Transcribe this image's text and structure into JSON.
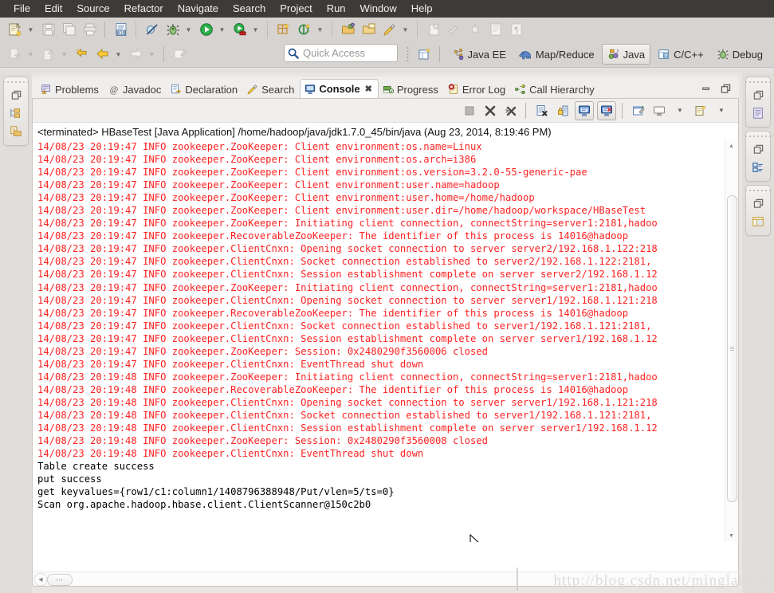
{
  "menu": {
    "items": [
      {
        "label": "File"
      },
      {
        "label": "Edit"
      },
      {
        "label": "Source"
      },
      {
        "label": "Refactor"
      },
      {
        "label": "Navigate"
      },
      {
        "label": "Search"
      },
      {
        "label": "Project"
      },
      {
        "label": "Run"
      },
      {
        "label": "Window"
      },
      {
        "label": "Help"
      }
    ]
  },
  "toolbar": {
    "quick_access_placeholder": "Quick Access",
    "icons_row1": [
      "new-wizard-icon",
      "save-icon",
      "save-all-icon",
      "print-icon",
      "toggle-source-icon",
      "skip-breakpoints-icon",
      "debug-icon",
      "run-icon",
      "run-external-tools-icon",
      "new-java-package-icon",
      "new-java-class-icon",
      "open-type-icon",
      "open-task-icon",
      "search-icon"
    ],
    "icons_row2": [
      "previous-annotation-icon",
      "next-annotation-icon",
      "last-edit-icon",
      "back-icon",
      "forward-icon",
      "pin-editor-icon"
    ]
  },
  "perspectives": {
    "items": [
      {
        "label": "Java EE",
        "icon": "java-ee-perspective-icon",
        "active": false
      },
      {
        "label": "Map/Reduce",
        "icon": "map-reduce-perspective-icon",
        "active": false
      },
      {
        "label": "Java",
        "icon": "java-perspective-icon",
        "active": true
      },
      {
        "label": "C/C++",
        "icon": "c-cpp-perspective-icon",
        "active": false
      },
      {
        "label": "Debug",
        "icon": "debug-perspective-icon",
        "active": false
      }
    ],
    "open_perspective_label": "Open Perspective"
  },
  "view_tabs": [
    {
      "label": "Problems",
      "icon": "problems-icon",
      "active": false
    },
    {
      "label": "Javadoc",
      "icon": "javadoc-icon",
      "active": false
    },
    {
      "label": "Declaration",
      "icon": "declaration-icon",
      "active": false
    },
    {
      "label": "Search",
      "icon": "search-view-icon",
      "active": false
    },
    {
      "label": "Console",
      "icon": "console-icon",
      "active": true,
      "close": "✖"
    },
    {
      "label": "Progress",
      "icon": "progress-icon",
      "active": false
    },
    {
      "label": "Error Log",
      "icon": "error-log-icon",
      "active": false
    },
    {
      "label": "Call Hierarchy",
      "icon": "call-hierarchy-icon",
      "active": false
    }
  ],
  "part_buttons": {
    "minimize": "minimize-icon",
    "maximize": "maximize-icon"
  },
  "console": {
    "toolbar_icons": [
      "terminate-icon",
      "remove-launch-icon",
      "remove-all-terminated-icon",
      "clear-console-icon",
      "scroll-lock-icon",
      "show-console-on-output-icon",
      "show-console-on-error-icon",
      "pin-console-icon",
      "display-selected-console-icon",
      "open-console-icon"
    ],
    "terminated_line": "<terminated> HBaseTest [Java Application] /home/hadoop/java/jdk1.7.0_45/bin/java (Aug 23, 2014, 8:19:46 PM)",
    "lines": [
      {
        "text": "14/08/23 20:19:47 INFO zookeeper.ZooKeeper: Client environment:os.name=Linux",
        "stream": "err"
      },
      {
        "text": "14/08/23 20:19:47 INFO zookeeper.ZooKeeper: Client environment:os.arch=i386",
        "stream": "err"
      },
      {
        "text": "14/08/23 20:19:47 INFO zookeeper.ZooKeeper: Client environment:os.version=3.2.0-55-generic-pae",
        "stream": "err"
      },
      {
        "text": "14/08/23 20:19:47 INFO zookeeper.ZooKeeper: Client environment:user.name=hadoop",
        "stream": "err"
      },
      {
        "text": "14/08/23 20:19:47 INFO zookeeper.ZooKeeper: Client environment:user.home=/home/hadoop",
        "stream": "err"
      },
      {
        "text": "14/08/23 20:19:47 INFO zookeeper.ZooKeeper: Client environment:user.dir=/home/hadoop/workspace/HBaseTest",
        "stream": "err"
      },
      {
        "text": "14/08/23 20:19:47 INFO zookeeper.ZooKeeper: Initiating client connection, connectString=server1:2181,hadoo",
        "stream": "err"
      },
      {
        "text": "14/08/23 20:19:47 INFO zookeeper.RecoverableZooKeeper: The identifier of this process is 14016@hadoop",
        "stream": "err"
      },
      {
        "text": "14/08/23 20:19:47 INFO zookeeper.ClientCnxn: Opening socket connection to server server2/192.168.1.122:218",
        "stream": "err"
      },
      {
        "text": "14/08/23 20:19:47 INFO zookeeper.ClientCnxn: Socket connection established to server2/192.168.1.122:2181,",
        "stream": "err"
      },
      {
        "text": "14/08/23 20:19:47 INFO zookeeper.ClientCnxn: Session establishment complete on server server2/192.168.1.12",
        "stream": "err"
      },
      {
        "text": "14/08/23 20:19:47 INFO zookeeper.ZooKeeper: Initiating client connection, connectString=server1:2181,hadoo",
        "stream": "err"
      },
      {
        "text": "14/08/23 20:19:47 INFO zookeeper.ClientCnxn: Opening socket connection to server server1/192.168.1.121:218",
        "stream": "err"
      },
      {
        "text": "14/08/23 20:19:47 INFO zookeeper.RecoverableZooKeeper: The identifier of this process is 14016@hadoop",
        "stream": "err"
      },
      {
        "text": "14/08/23 20:19:47 INFO zookeeper.ClientCnxn: Socket connection established to server1/192.168.1.121:2181,",
        "stream": "err"
      },
      {
        "text": "14/08/23 20:19:47 INFO zookeeper.ClientCnxn: Session establishment complete on server server1/192.168.1.12",
        "stream": "err"
      },
      {
        "text": "14/08/23 20:19:47 INFO zookeeper.ZooKeeper: Session: 0x2480290f3560006 closed",
        "stream": "err"
      },
      {
        "text": "14/08/23 20:19:47 INFO zookeeper.ClientCnxn: EventThread shut down",
        "stream": "err"
      },
      {
        "text": "14/08/23 20:19:48 INFO zookeeper.ZooKeeper: Initiating client connection, connectString=server1:2181,hadoo",
        "stream": "err"
      },
      {
        "text": "14/08/23 20:19:48 INFO zookeeper.RecoverableZooKeeper: The identifier of this process is 14016@hadoop",
        "stream": "err"
      },
      {
        "text": "14/08/23 20:19:48 INFO zookeeper.ClientCnxn: Opening socket connection to server server1/192.168.1.121:218",
        "stream": "err"
      },
      {
        "text": "14/08/23 20:19:48 INFO zookeeper.ClientCnxn: Socket connection established to server1/192.168.1.121:2181,",
        "stream": "err"
      },
      {
        "text": "14/08/23 20:19:48 INFO zookeeper.ClientCnxn: Session establishment complete on server server1/192.168.1.12",
        "stream": "err"
      },
      {
        "text": "14/08/23 20:19:48 INFO zookeeper.ZooKeeper: Session: 0x2480290f3560008 closed",
        "stream": "err"
      },
      {
        "text": "14/08/23 20:19:48 INFO zookeeper.ClientCnxn: EventThread shut down",
        "stream": "err"
      },
      {
        "text": "Table create success",
        "stream": "out"
      },
      {
        "text": "put success",
        "stream": "out"
      },
      {
        "text": "get keyvalues={row1/c1:column1/1408796388948/Put/vlen=5/ts=0}",
        "stream": "out"
      },
      {
        "text": "Scan org.apache.hadoop.hbase.client.ClientScanner@150c2b0",
        "stream": "out"
      }
    ]
  },
  "trim": {
    "left_stack": [
      "restore-icon",
      "package-explorer-icon",
      "project-explorer-icon"
    ],
    "right_stacks": [
      [
        "restore-icon",
        "outline-view-icon"
      ],
      [
        "restore-icon",
        "task-list-icon"
      ],
      [
        "restore-icon",
        "templates-view-icon"
      ]
    ]
  },
  "watermark": "http://blog.csdn.net/minglaihan",
  "colors": {
    "menubar_bg": "#3c3b37",
    "toolbar_bg": "#d6d3d0",
    "stderr_text": "#ff2222",
    "stdout_text": "#000000",
    "console_bg": "#ffffff"
  }
}
